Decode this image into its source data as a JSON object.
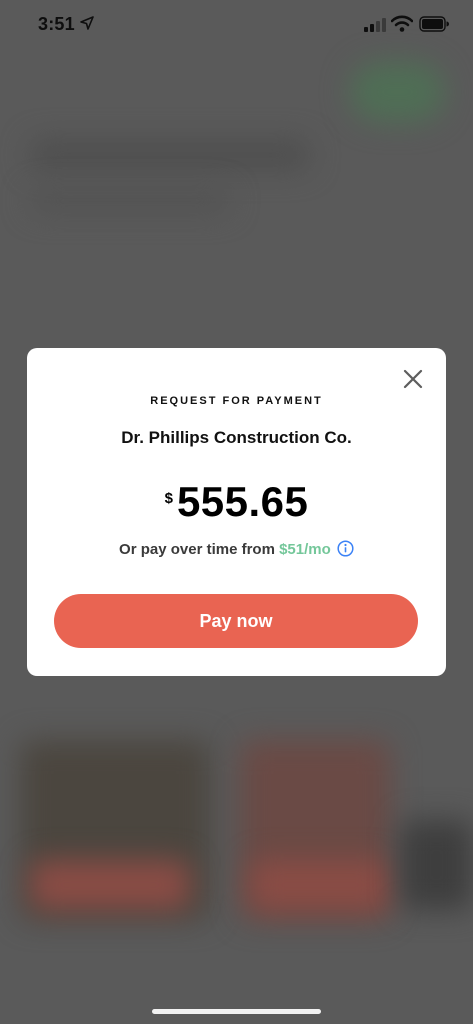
{
  "status_bar": {
    "time": "3:51",
    "location_icon": "location-arrow-icon",
    "signal_icon": "cellular-signal-icon",
    "wifi_icon": "wifi-icon",
    "battery_icon": "battery-icon"
  },
  "modal": {
    "close_icon": "close-icon",
    "eyebrow": "REQUEST FOR PAYMENT",
    "merchant": "Dr. Phillips Construction Co.",
    "currency_symbol": "$",
    "amount": "555.65",
    "financing_prefix": "Or pay over time from ",
    "financing_monthly": "$51/mo",
    "info_icon": "info-icon",
    "pay_button_label": "Pay now"
  },
  "colors": {
    "overlay": "#5a5a5a",
    "pay_button": "#e96452",
    "monthly_text": "#74c79a",
    "info_icon": "#3b82f6"
  }
}
